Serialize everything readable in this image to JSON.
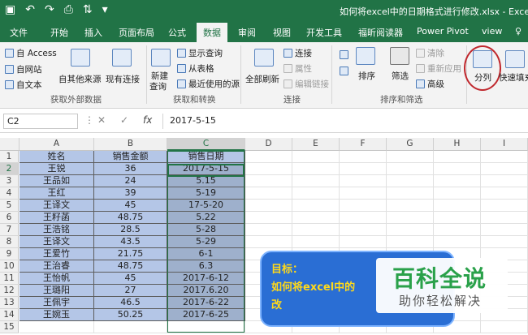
{
  "window": {
    "title": "如何将excel中的日期格式进行修改.xlsx - Exce"
  },
  "tabs": [
    {
      "label": "文件"
    },
    {
      "label": "开始"
    },
    {
      "label": "插入"
    },
    {
      "label": "页面布局"
    },
    {
      "label": "公式"
    },
    {
      "label": "数据"
    },
    {
      "label": "审阅"
    },
    {
      "label": "视图"
    },
    {
      "label": "开发工具"
    },
    {
      "label": "福昕阅读器"
    },
    {
      "label": "Power Pivot"
    },
    {
      "label": "view"
    }
  ],
  "ribbon": {
    "external": {
      "access": "自 Access",
      "web": "自网站",
      "text": "自文本",
      "other": "自其他来源",
      "existing": "现有连接",
      "group": "获取外部数据"
    },
    "transform": {
      "new_query": "新建",
      "new_query2": "查询",
      "show_query": "显示查询",
      "from_table": "从表格",
      "recent": "最近使用的源",
      "group": "获取和转换"
    },
    "connections": {
      "refresh_all": "全部刷新",
      "connections": "连接",
      "properties": "属性",
      "edit_links": "编辑链接",
      "group": "连接"
    },
    "sort_filter": {
      "sort": "排序",
      "filter": "筛选",
      "clear": "清除",
      "reapply": "重新应用",
      "advanced": "高级",
      "group": "排序和筛选"
    },
    "tools": {
      "text_to_columns": "分列",
      "flash_fill": "快速填充"
    }
  },
  "formula_bar": {
    "name_box": "C2",
    "fx": "fx",
    "formula": "2017-5-15"
  },
  "columns": [
    "A",
    "B",
    "C",
    "D",
    "E",
    "F",
    "G",
    "H",
    "I"
  ],
  "rows": [
    "1",
    "2",
    "3",
    "4",
    "5",
    "6",
    "7",
    "8",
    "9",
    "10",
    "11",
    "12",
    "13",
    "14",
    "15"
  ],
  "table": {
    "headers": [
      "姓名",
      "销售金额",
      "销售日期"
    ],
    "names": [
      "王锐",
      "王品如",
      "王红",
      "王译文",
      "王籽菡",
      "王浩铭",
      "王译文",
      "王爱竹",
      "王治睿",
      "王怡帆",
      "王璐阳",
      "王佩宇",
      "王婉玉"
    ],
    "amounts": [
      "36",
      "24",
      "39",
      "45",
      "48.75",
      "28.5",
      "43.5",
      "21.75",
      "48.75",
      "45",
      "27",
      "46.5",
      "50.25"
    ],
    "dates": [
      "2017-5-15",
      "5.15",
      "5-19",
      "17-5-20",
      "5.22",
      "5-28",
      "5-29",
      "6-1",
      "6.3",
      "2017-6-12",
      "2017.6.20",
      "2017-6-22",
      "2017-6-25"
    ]
  },
  "callout": {
    "line1": "目标：",
    "line2": "如何将excel中的",
    "line3": "改"
  },
  "watermark": {
    "main": "百科全说",
    "sub": "助你轻松解决"
  },
  "colors": {
    "excel_green": "#217346",
    "header_fill": "#b4c6e7",
    "callout_blue": "#2a6ed4",
    "callout_text": "#ffd91a",
    "highlight_circle": "#c0282d"
  }
}
